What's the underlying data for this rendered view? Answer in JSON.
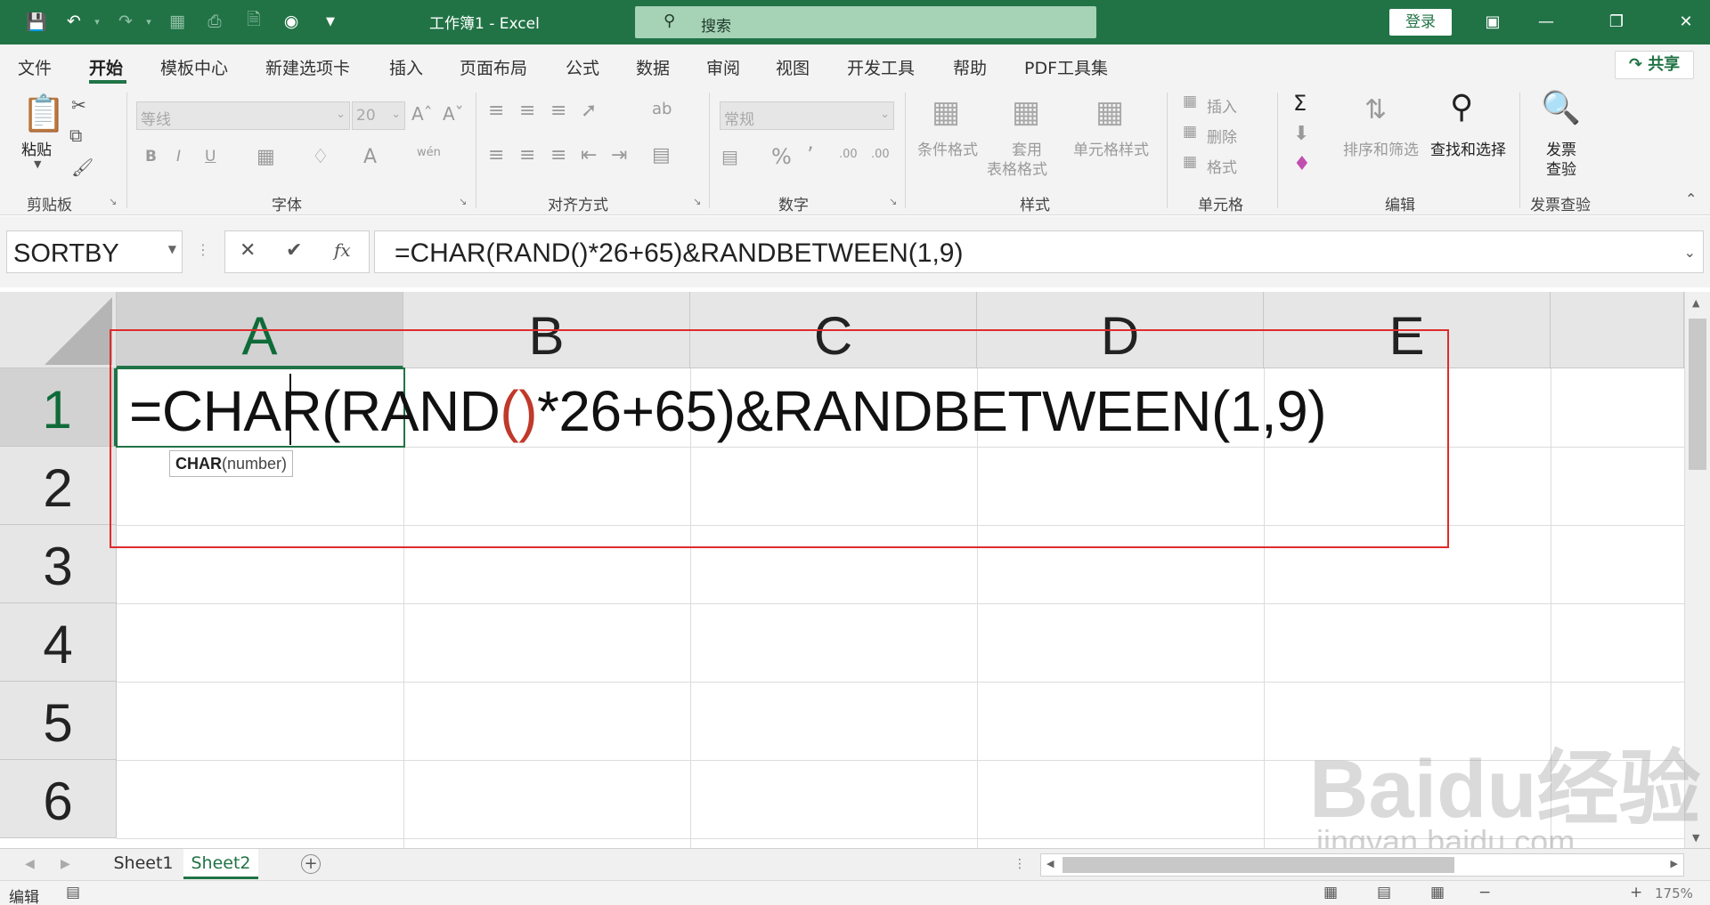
{
  "titlebar": {
    "doc_title": "工作簿1  -  Excel",
    "search_placeholder": "搜索",
    "login_label": "登录"
  },
  "menu": {
    "tabs": [
      "文件",
      "开始",
      "模板中心",
      "新建选项卡",
      "插入",
      "页面布局",
      "公式",
      "数据",
      "审阅",
      "视图",
      "开发工具",
      "帮助",
      "PDF工具集"
    ],
    "active_tab": "开始",
    "share_label": "共享"
  },
  "ribbon": {
    "groups": [
      "剪贴板",
      "字体",
      "对齐方式",
      "数字",
      "样式",
      "单元格",
      "编辑",
      "发票查验"
    ],
    "paste_label": "粘贴",
    "font_name": "等线",
    "font_size": "20",
    "number_format": "常规",
    "cond_format_label": "条件格式",
    "table_format_label_1": "套用",
    "table_format_label_2": "表格格式",
    "cell_style_label": "单元格样式",
    "insert_label": "插入",
    "delete_label": "删除",
    "format_label": "格式",
    "sort_filter_label": "排序和筛选",
    "find_select_label": "查找和选择",
    "invoice_label_1": "发票",
    "invoice_label_2": "查验"
  },
  "formula_bar": {
    "name_box": "SORTBY",
    "formula": "=CHAR(RAND()*26+65)&RANDBETWEEN(1,9)"
  },
  "grid": {
    "columns": [
      "A",
      "B",
      "C",
      "D",
      "E"
    ],
    "rows": [
      "1",
      "2",
      "3",
      "4",
      "5",
      "6"
    ],
    "cell_before_paren": "=CHAR(RAND",
    "cell_paren": "()",
    "cell_after_paren": "*26+65)&RANDBETWEEN(1,9)",
    "tooltip_fn": "CHAR",
    "tooltip_args": "(number)"
  },
  "sheets": {
    "tabs": [
      "Sheet1",
      "Sheet2"
    ],
    "active": "Sheet2"
  },
  "status": {
    "mode": "编辑",
    "zoom": "175%"
  },
  "watermark": {
    "main": "Baidu经验",
    "sub": "jingyan.baidu.com"
  },
  "colors": {
    "excel_green": "#217346",
    "highlight_red": "#e02b2b",
    "paren_red": "#c0392b"
  }
}
